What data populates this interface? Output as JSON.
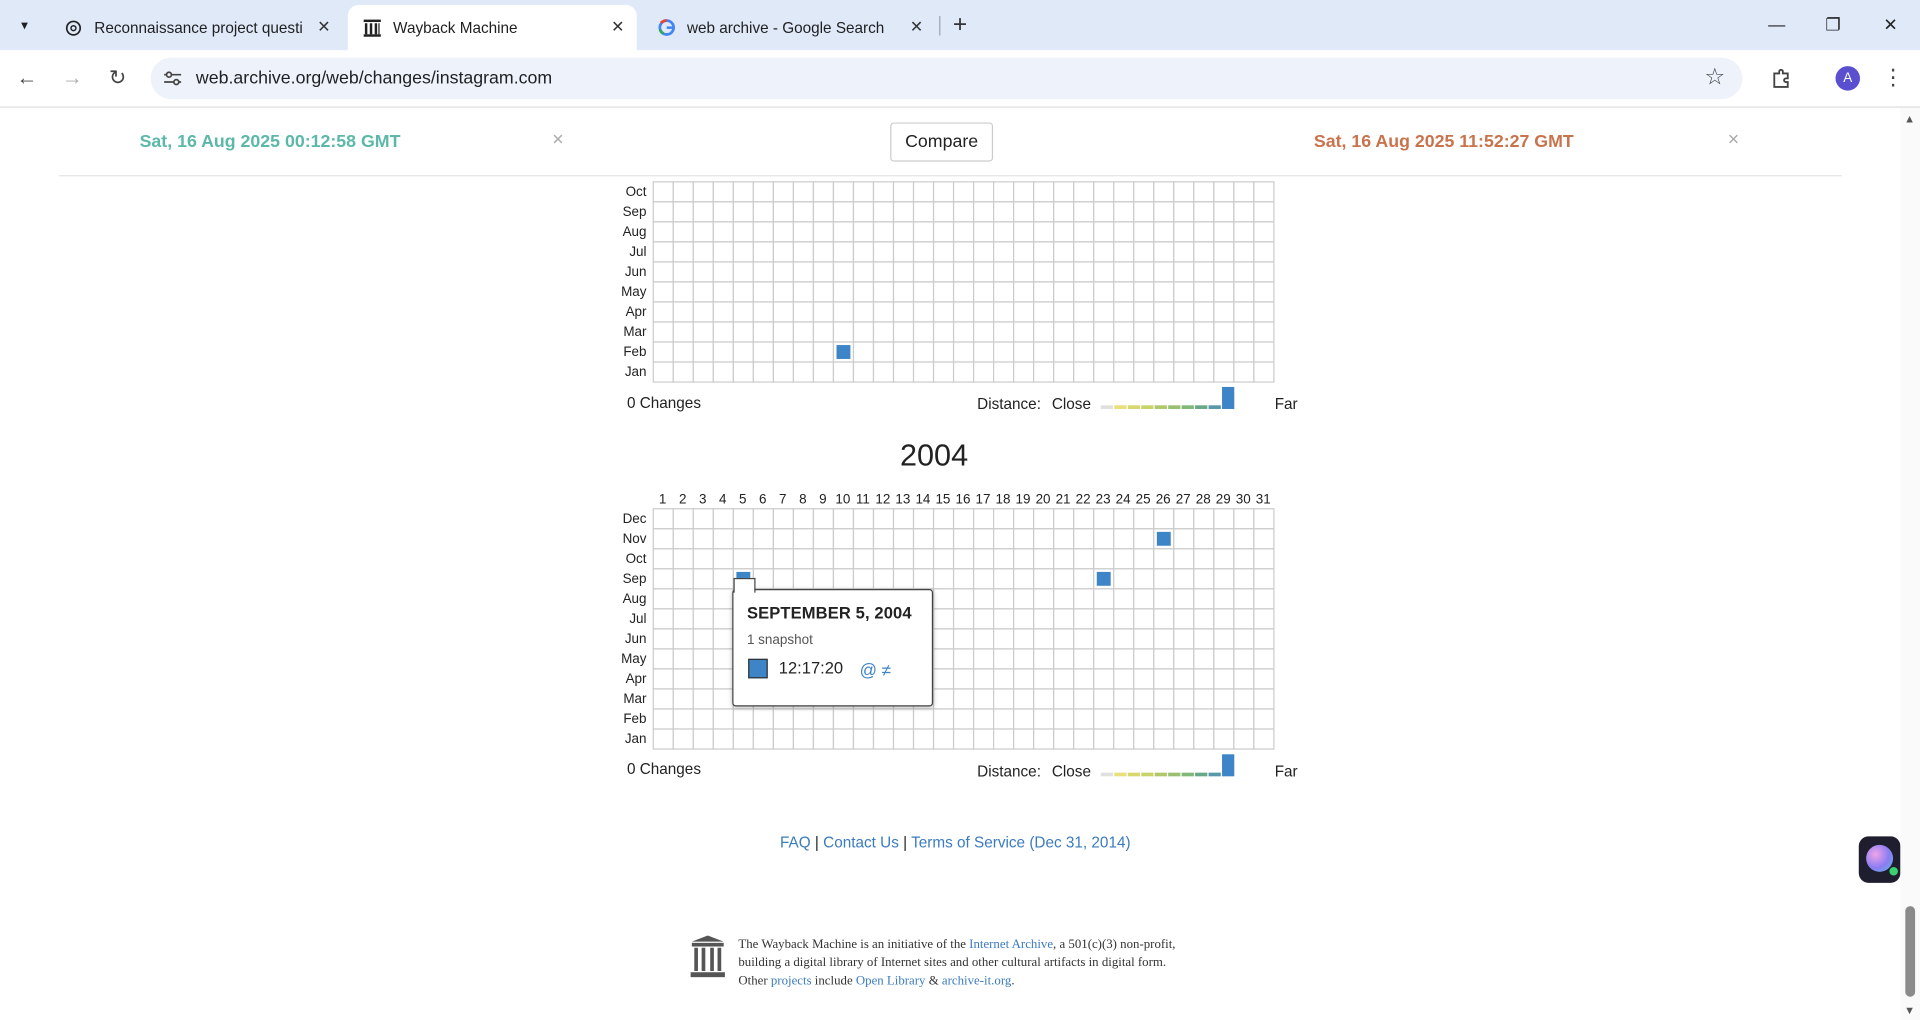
{
  "browser": {
    "tabs": [
      {
        "label": "Reconnaissance project questio",
        "icon": "openai-icon",
        "active": false
      },
      {
        "label": "Wayback Machine",
        "icon": "wayback-icon",
        "active": true
      },
      {
        "label": "web archive - Google Search",
        "icon": "google-icon",
        "active": false
      }
    ],
    "url": "web.archive.org/web/changes/instagram.com",
    "profile_initial": "A"
  },
  "compare_bar": {
    "left_date": "Sat, 16 Aug 2025 00:12:58 GMT",
    "right_date": "Sat, 16 Aug 2025 11:52:27 GMT",
    "compare_label": "Compare",
    "close_glyph": "×",
    "left_color": "#5cb8a8",
    "right_color": "#c9734d"
  },
  "calendars": [
    {
      "year": "",
      "visible_months": [
        "Oct",
        "Sep",
        "Aug",
        "Jul",
        "Jun",
        "May",
        "Apr",
        "Mar",
        "Feb",
        "Jan"
      ],
      "snapshots": [
        {
          "month": "Feb",
          "day": 10
        }
      ],
      "changes_label": "0 Changes"
    },
    {
      "year": "2004",
      "visible_months": [
        "Dec",
        "Nov",
        "Oct",
        "Sep",
        "Aug",
        "Jul",
        "Jun",
        "May",
        "Apr",
        "Mar",
        "Feb",
        "Jan"
      ],
      "snapshots": [
        {
          "month": "Nov",
          "day": 26
        },
        {
          "month": "Sep",
          "day": 5
        },
        {
          "month": "Sep",
          "day": 23
        }
      ],
      "changes_label": "0 Changes"
    }
  ],
  "days": [
    "1",
    "2",
    "3",
    "4",
    "5",
    "6",
    "7",
    "8",
    "9",
    "10",
    "11",
    "12",
    "13",
    "14",
    "15",
    "16",
    "17",
    "18",
    "19",
    "20",
    "21",
    "22",
    "23",
    "24",
    "25",
    "26",
    "27",
    "28",
    "29",
    "30",
    "31"
  ],
  "legend": {
    "distance_label": "Distance:",
    "close_label": "Close",
    "far_label": "Far",
    "scale_colors": [
      "#e0e0e0",
      "#e8e07a",
      "#d8d870",
      "#c8d468",
      "#b0c868",
      "#98c070",
      "#80b878",
      "#68a888",
      "#5898a8",
      "#3d85c6"
    ],
    "snapshot_color": "#3d85c6"
  },
  "tooltip": {
    "title": "SEPTEMBER 5, 2004",
    "count": "1 snapshot",
    "time": "12:17:20",
    "at_glyph": "@",
    "ne_glyph": "≠"
  },
  "footer": {
    "faq": "FAQ",
    "contact": "Contact Us",
    "tos": "Terms of Service (Dec 31, 2014)",
    "sep": "|"
  },
  "about": {
    "line1_a": "The Wayback Machine is an initiative of the ",
    "line1_link": "Internet Archive",
    "line1_b": ", a 501(c)(3) non-profit,",
    "line2": "building a digital library of Internet sites and other cultural artifacts in digital form.",
    "line3_a": "Other ",
    "line3_link1": "projects",
    "line3_b": " include ",
    "line3_link2": "Open Library",
    "line3_c": " & ",
    "line3_link3": "archive-it.org",
    "line3_d": "."
  }
}
